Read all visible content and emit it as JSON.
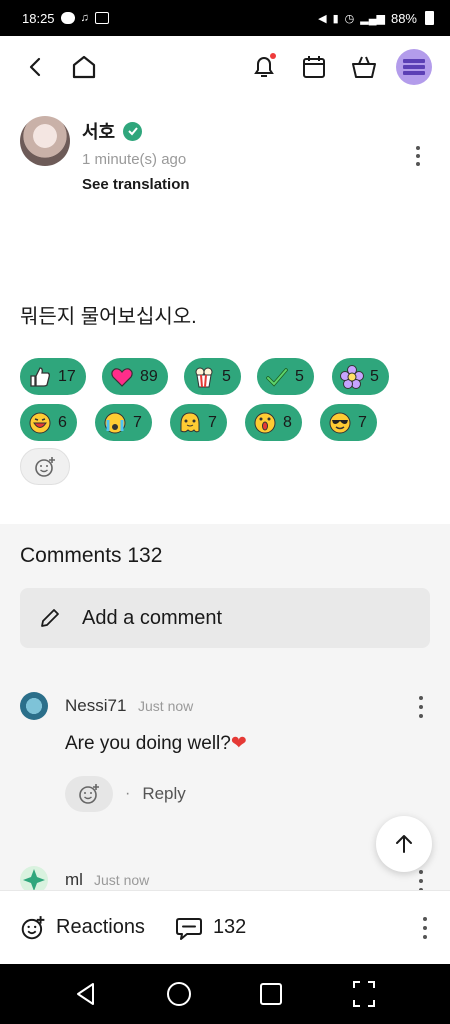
{
  "status_bar": {
    "time": "18:25",
    "battery_percent": "88%"
  },
  "post": {
    "author": "서호",
    "time": "1 minute(s) ago",
    "see_translation": "See translation",
    "body": "뭐든지 물어보십시오."
  },
  "reactions": [
    {
      "icon": "thumbs-up-icon",
      "count": "17"
    },
    {
      "icon": "heart-icon",
      "count": "89"
    },
    {
      "icon": "popcorn-icon",
      "count": "5"
    },
    {
      "icon": "checkmark-icon",
      "count": "5"
    },
    {
      "icon": "flower-icon",
      "count": "5"
    },
    {
      "icon": "laughing-face-icon",
      "count": "6"
    },
    {
      "icon": "crying-face-icon",
      "count": "7"
    },
    {
      "icon": "melting-face-icon",
      "count": "7"
    },
    {
      "icon": "surprised-face-icon",
      "count": "8"
    },
    {
      "icon": "sunglasses-face-icon",
      "count": "7"
    }
  ],
  "comments": {
    "title": "Comments 132",
    "add_placeholder": "Add a comment",
    "items": [
      {
        "name": "Nessi71",
        "time": "Just now",
        "text": "Are you doing well?",
        "reply": "Reply",
        "separator": "·"
      },
      {
        "name": "ml",
        "time": "Just now"
      }
    ]
  },
  "bottom_bar": {
    "reactions_label": "Reactions",
    "comment_count": "132"
  },
  "colors": {
    "accent_green": "#2fa67c",
    "menu_purple": "#b39ceb",
    "notification_dot": "#ee3b3b",
    "heart_red": "#e53935"
  }
}
